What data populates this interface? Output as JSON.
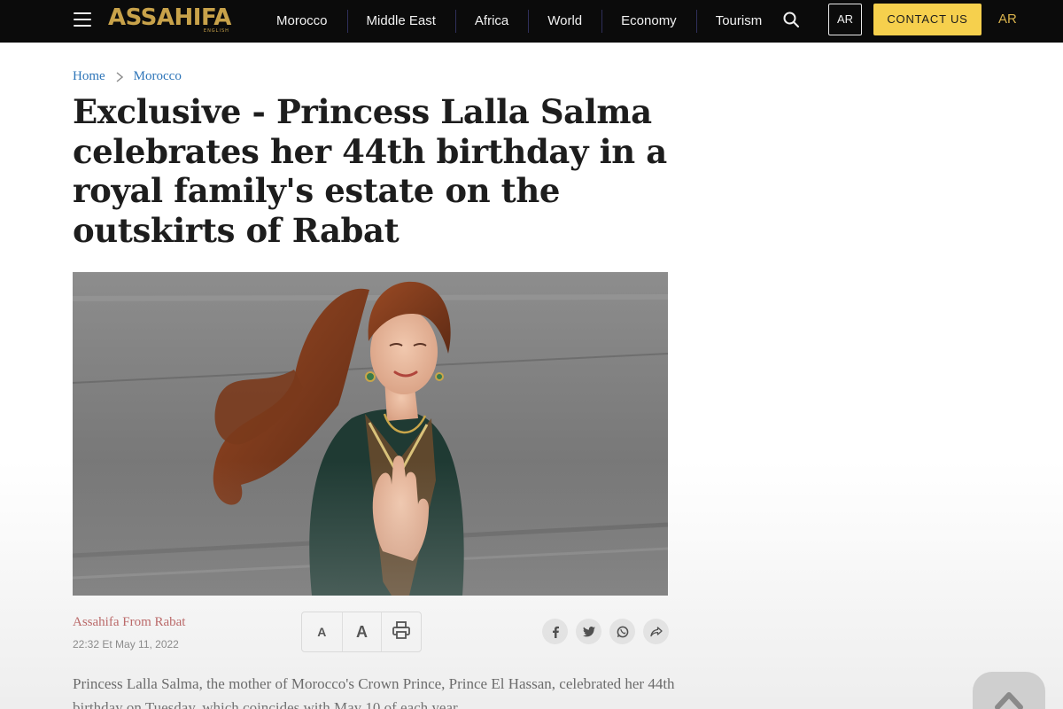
{
  "header": {
    "logo_text": "ASSAHIFA",
    "logo_subtext": "ENGLISH",
    "nav": [
      {
        "label": "Morocco"
      },
      {
        "label": "Middle East"
      },
      {
        "label": "Africa"
      },
      {
        "label": "World"
      },
      {
        "label": "Economy"
      },
      {
        "label": "Tourism"
      }
    ],
    "lang_box_label": "AR",
    "contact_label": "CONTACT US",
    "ar_link_label": "AR"
  },
  "breadcrumb": [
    {
      "label": "Home"
    },
    {
      "label": "Morocco"
    }
  ],
  "article": {
    "title": "Exclusive - Princess Lalla Salma celebrates her 44th birthday in a royal family's estate on the outskirts of Rabat",
    "author": "Assahifa From Rabat",
    "dateline": "22:32 Et May 11, 2022",
    "font_small_label": "A",
    "font_large_label": "A",
    "body_first": " Princess Lalla Salma, the mother of Morocco's Crown Prince, Prince El Hassan, celebrated her 44th birthday on Tuesday, which coincides with May 10 of each year."
  },
  "icons": {
    "menu": "hamburger-icon",
    "search": "search-icon",
    "breadcrumb_separator": "chevron-right-icon",
    "print": "printer-icon",
    "share": [
      "facebook-icon",
      "twitter-icon",
      "whatsapp-icon",
      "share-icon"
    ],
    "scroll_top": "arrow-up-icon"
  },
  "colors": {
    "topbar": "#0b0b0b",
    "logo": "#c8a24a",
    "contact_button": "#f6d04d",
    "breadcrumb_link": "#2c74b8",
    "author": "#b04040"
  }
}
